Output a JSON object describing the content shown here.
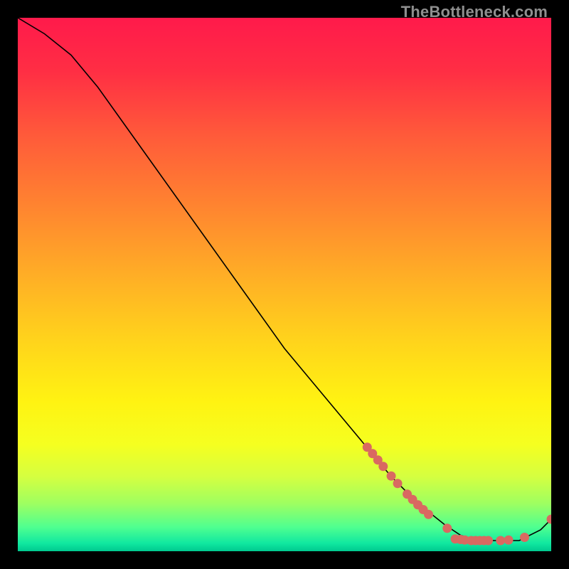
{
  "watermark": "TheBottleneck.com",
  "chart_data": {
    "type": "line",
    "title": "",
    "xlabel": "",
    "ylabel": "",
    "xlim": [
      0,
      100
    ],
    "ylim": [
      0,
      100
    ],
    "grid": false,
    "series": [
      {
        "name": "curve",
        "x": [
          0,
          5,
          10,
          15,
          20,
          25,
          30,
          35,
          40,
          45,
          50,
          55,
          60,
          65,
          70,
          75,
          80,
          83,
          86,
          90,
          94,
          98,
          100
        ],
        "y": [
          100,
          97,
          93,
          87,
          80,
          73,
          66,
          59,
          52,
          45,
          38,
          32,
          26,
          20,
          14,
          9,
          5,
          3,
          2,
          2,
          2,
          4,
          6
        ]
      }
    ],
    "markers": [
      {
        "x": 65.5,
        "y": 19.5
      },
      {
        "x": 66.5,
        "y": 18.3
      },
      {
        "x": 67.5,
        "y": 17.1
      },
      {
        "x": 68.5,
        "y": 15.9
      },
      {
        "x": 70.0,
        "y": 14.1
      },
      {
        "x": 71.2,
        "y": 12.7
      },
      {
        "x": 73.0,
        "y": 10.7
      },
      {
        "x": 74.0,
        "y": 9.7
      },
      {
        "x": 75.0,
        "y": 8.7
      },
      {
        "x": 76.0,
        "y": 7.8
      },
      {
        "x": 77.0,
        "y": 6.9
      },
      {
        "x": 80.5,
        "y": 4.3
      },
      {
        "x": 82.0,
        "y": 2.3
      },
      {
        "x": 83.0,
        "y": 2.2
      },
      {
        "x": 83.8,
        "y": 2.1
      },
      {
        "x": 85.0,
        "y": 2.0
      },
      {
        "x": 85.8,
        "y": 2.0
      },
      {
        "x": 86.6,
        "y": 2.0
      },
      {
        "x": 87.4,
        "y": 2.0
      },
      {
        "x": 88.2,
        "y": 2.0
      },
      {
        "x": 90.5,
        "y": 2.0
      },
      {
        "x": 92.0,
        "y": 2.1
      },
      {
        "x": 95.0,
        "y": 2.6
      },
      {
        "x": 100.0,
        "y": 6.0
      }
    ],
    "gradient_stops": [
      {
        "pos": 0.0,
        "color": "#ff1a4b"
      },
      {
        "pos": 0.1,
        "color": "#ff2e44"
      },
      {
        "pos": 0.22,
        "color": "#ff5a3a"
      },
      {
        "pos": 0.35,
        "color": "#ff8330"
      },
      {
        "pos": 0.48,
        "color": "#ffad26"
      },
      {
        "pos": 0.6,
        "color": "#ffd21c"
      },
      {
        "pos": 0.72,
        "color": "#fff312"
      },
      {
        "pos": 0.8,
        "color": "#f5ff20"
      },
      {
        "pos": 0.86,
        "color": "#d5ff40"
      },
      {
        "pos": 0.91,
        "color": "#9fff60"
      },
      {
        "pos": 0.955,
        "color": "#4fff90"
      },
      {
        "pos": 0.985,
        "color": "#10e8a0"
      },
      {
        "pos": 1.0,
        "color": "#00c98f"
      }
    ],
    "marker_color": "#d96961",
    "line_color": "#000000"
  }
}
